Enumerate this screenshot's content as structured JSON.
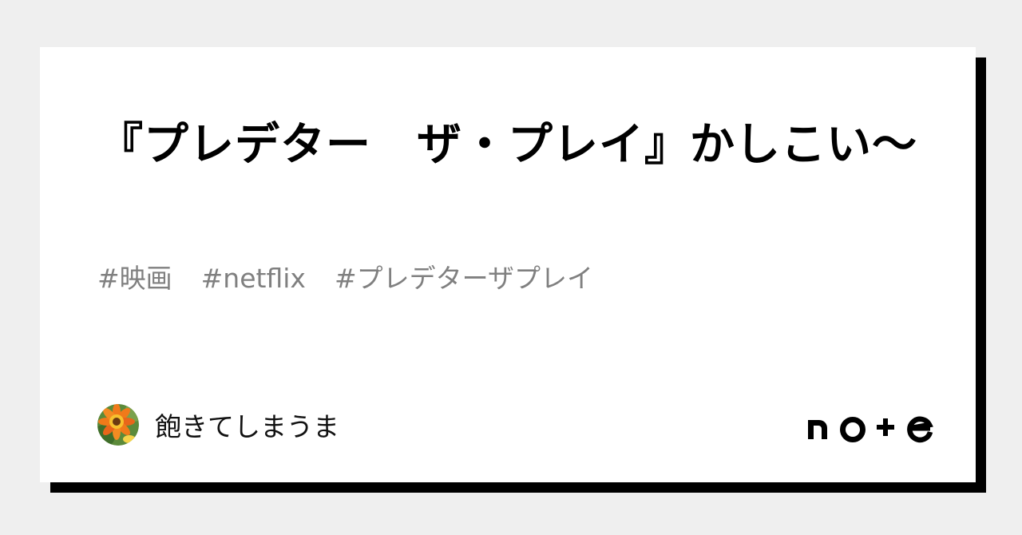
{
  "card": {
    "title": "『プレデター　ザ・プレイ』かしこい〜",
    "tags": [
      "#映画",
      "#netflix",
      "#プレデターザプレイ"
    ],
    "author": {
      "name": "飽きてしまうま",
      "avatar_icon": "flower-photo-avatar"
    }
  },
  "logo": {
    "text": "note",
    "color": "#000000"
  },
  "colors": {
    "background": "#efefef",
    "card": "#ffffff",
    "shadow": "#000000",
    "tag_text": "#808080"
  }
}
